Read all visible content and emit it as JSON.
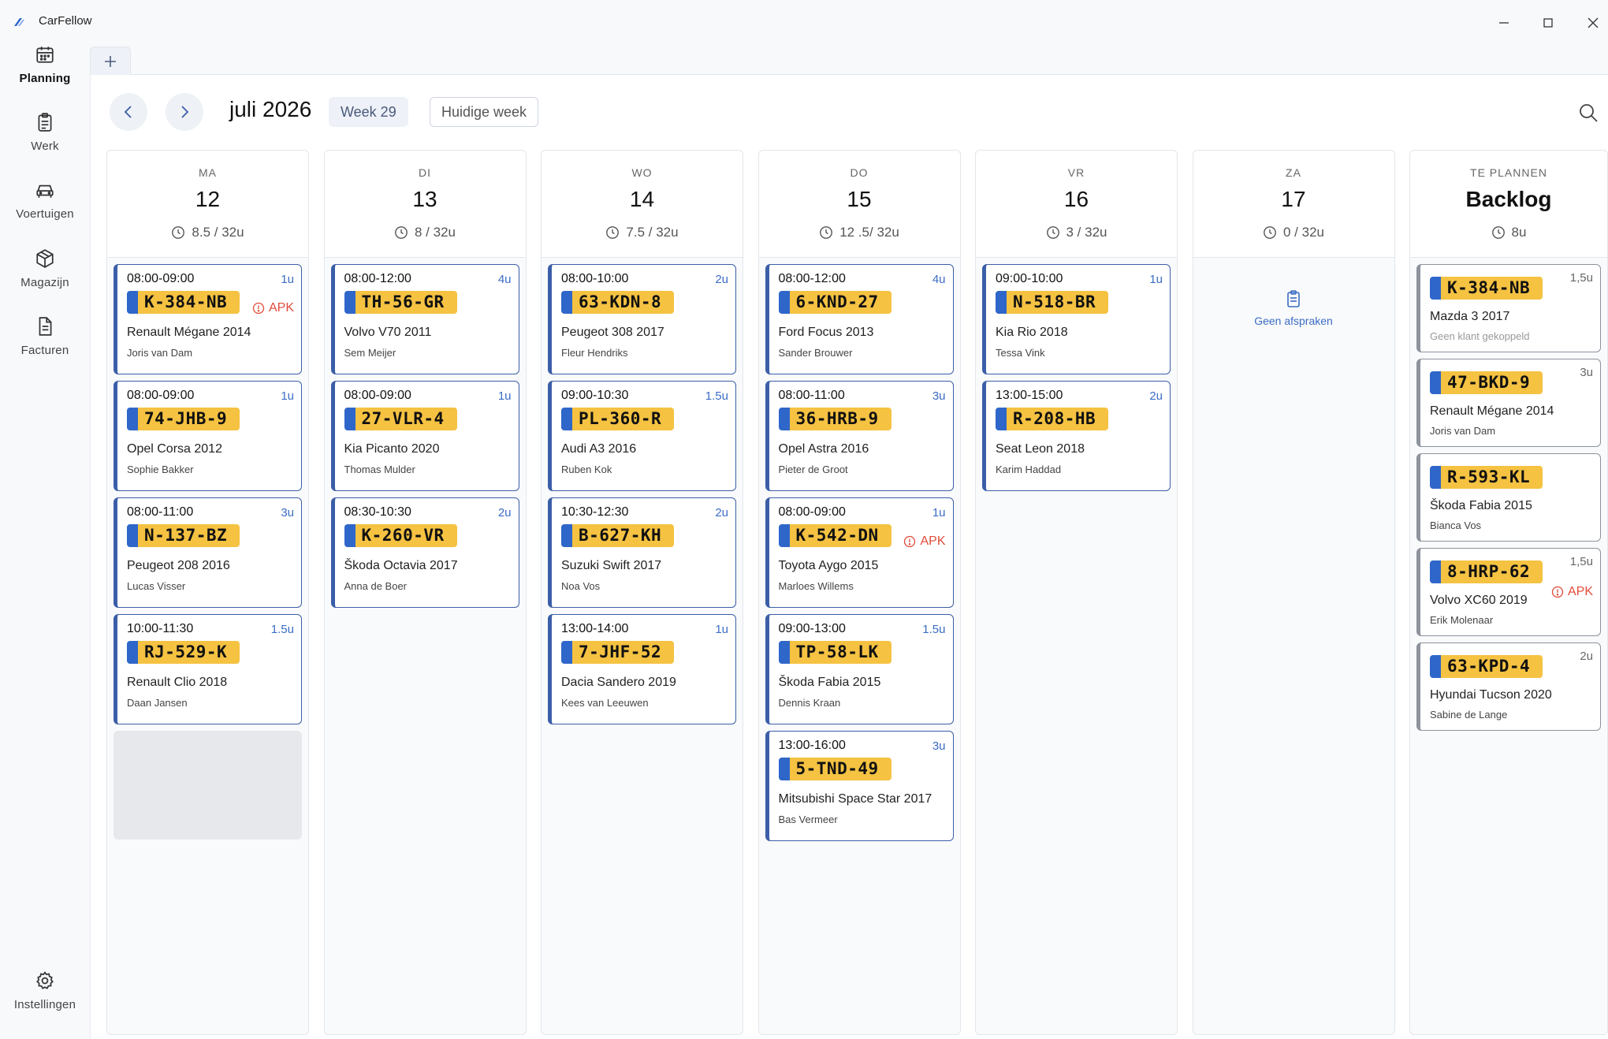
{
  "app": {
    "title": "CarFellow"
  },
  "sidebar": {
    "items": [
      {
        "label": "Planning"
      },
      {
        "label": "Werk"
      },
      {
        "label": "Voertuigen"
      },
      {
        "label": "Magazijn"
      },
      {
        "label": "Facturen"
      }
    ],
    "settings": {
      "label": "Instellingen"
    }
  },
  "toolbar": {
    "month": "juli 2026",
    "week": "Week 29",
    "current_week": "Huidige week"
  },
  "days": [
    {
      "day": "MA",
      "num": "12",
      "hours": "8.5 / 32u",
      "cards": [
        {
          "time": "08:00-09:00",
          "dur": "1u",
          "plate": "K-384-NB",
          "car": "Renault Mégane 2014",
          "client": "Joris van Dam",
          "apk": "APK"
        },
        {
          "time": "08:00-09:00",
          "dur": "1u",
          "plate": "74-JHB-9",
          "car": "Opel Corsa 2012",
          "client": "Sophie Bakker"
        },
        {
          "time": "08:00-11:00",
          "dur": "3u",
          "plate": "N-137-BZ",
          "car": "Peugeot 208 2016",
          "client": "Lucas Visser"
        },
        {
          "time": "10:00-11:30",
          "dur": "1.5u",
          "plate": "RJ-529-K",
          "car": "Renault Clio 2018",
          "client": "Daan Jansen"
        }
      ]
    },
    {
      "day": "DI",
      "num": "13",
      "hours": "8 / 32u",
      "cards": [
        {
          "time": "08:00-12:00",
          "dur": "4u",
          "plate": "TH-56-GR",
          "car": "Volvo V70 2011",
          "client": "Sem Meijer"
        },
        {
          "time": "08:00-09:00",
          "dur": "1u",
          "plate": "27-VLR-4",
          "car": "Kia Picanto 2020",
          "client": "Thomas Mulder"
        },
        {
          "time": "08:30-10:30",
          "dur": "2u",
          "plate": "K-260-VR",
          "car": "Škoda Octavia 2017",
          "client": "Anna de Boer"
        }
      ]
    },
    {
      "day": "WO",
      "num": "14",
      "hours": "7.5 / 32u",
      "cards": [
        {
          "time": "08:00-10:00",
          "dur": "2u",
          "plate": "63-KDN-8",
          "car": "Peugeot 308 2017",
          "client": "Fleur Hendriks"
        },
        {
          "time": "09:00-10:30",
          "dur": "1.5u",
          "plate": "PL-360-R",
          "car": "Audi A3 2016",
          "client": "Ruben Kok"
        },
        {
          "time": "10:30-12:30",
          "dur": "2u",
          "plate": "B-627-KH",
          "car": "Suzuki Swift 2017",
          "client": "Noa Vos"
        },
        {
          "time": "13:00-14:00",
          "dur": "1u",
          "plate": "7-JHF-52",
          "car": "Dacia Sandero 2019",
          "client": "Kees van Leeuwen"
        }
      ]
    },
    {
      "day": "DO",
      "num": "15",
      "hours": "12 .5/ 32u",
      "cards": [
        {
          "time": "08:00-12:00",
          "dur": "4u",
          "plate": "6-KND-27",
          "car": "Ford Focus 2013",
          "client": "Sander Brouwer"
        },
        {
          "time": "08:00-11:00",
          "dur": "3u",
          "plate": "36-HRB-9",
          "car": "Opel Astra 2016",
          "client": "Pieter de Groot"
        },
        {
          "time": "08:00-09:00",
          "dur": "1u",
          "plate": "K-542-DN",
          "car": "Toyota Aygo 2015",
          "client": "Marloes Willems",
          "apk": "APK"
        },
        {
          "time": "09:00-13:00",
          "dur": "1.5u",
          "plate": "TP-58-LK",
          "car": "Škoda Fabia 2015",
          "client": "Dennis Kraan"
        },
        {
          "time": "13:00-16:00",
          "dur": "3u",
          "plate": "5-TND-49",
          "car": "Mitsubishi Space Star 2017",
          "client": "Bas Vermeer"
        }
      ]
    },
    {
      "day": "VR",
      "num": "16",
      "hours": "3 / 32u",
      "cards": [
        {
          "time": "09:00-10:00",
          "dur": "1u",
          "plate": "N-518-BR",
          "car": "Kia Rio 2018",
          "client": "Tessa Vink"
        },
        {
          "time": "13:00-15:00",
          "dur": "2u",
          "plate": "R-208-HB",
          "car": "Seat Leon 2018",
          "client": "Karim Haddad"
        }
      ]
    },
    {
      "day": "ZA",
      "num": "17",
      "hours": "0 / 32u",
      "empty": "Geen afspraken",
      "cards": []
    }
  ],
  "backlog": {
    "day": "TE PLANNEN",
    "title": "Backlog",
    "hours": "8u",
    "cards": [
      {
        "dur": "1,5u",
        "plate": "K-384-NB",
        "car": "Mazda 3 2017",
        "client": "Geen klant gekoppeld",
        "no_client": true
      },
      {
        "dur": "3u",
        "plate": "47-BKD-9",
        "car": "Renault Mégane 2014",
        "client": "Joris van Dam"
      },
      {
        "dur": "",
        "plate": "R-593-KL",
        "car": "Škoda Fabia 2015",
        "client": "Bianca Vos"
      },
      {
        "dur": "1,5u",
        "plate": "8-HRP-62",
        "car": "Volvo XC60 2019",
        "client": "Erik Molenaar",
        "apk": "APK"
      },
      {
        "dur": "2u",
        "plate": "63-KPD-4",
        "car": "Hyundai Tucson 2020",
        "client": "Sabine de Lange"
      }
    ]
  },
  "colors": {
    "accent": "#3b5ea8",
    "plate": "#f5c242",
    "eu": "#2f66c9",
    "warning": "#e04b3a"
  }
}
